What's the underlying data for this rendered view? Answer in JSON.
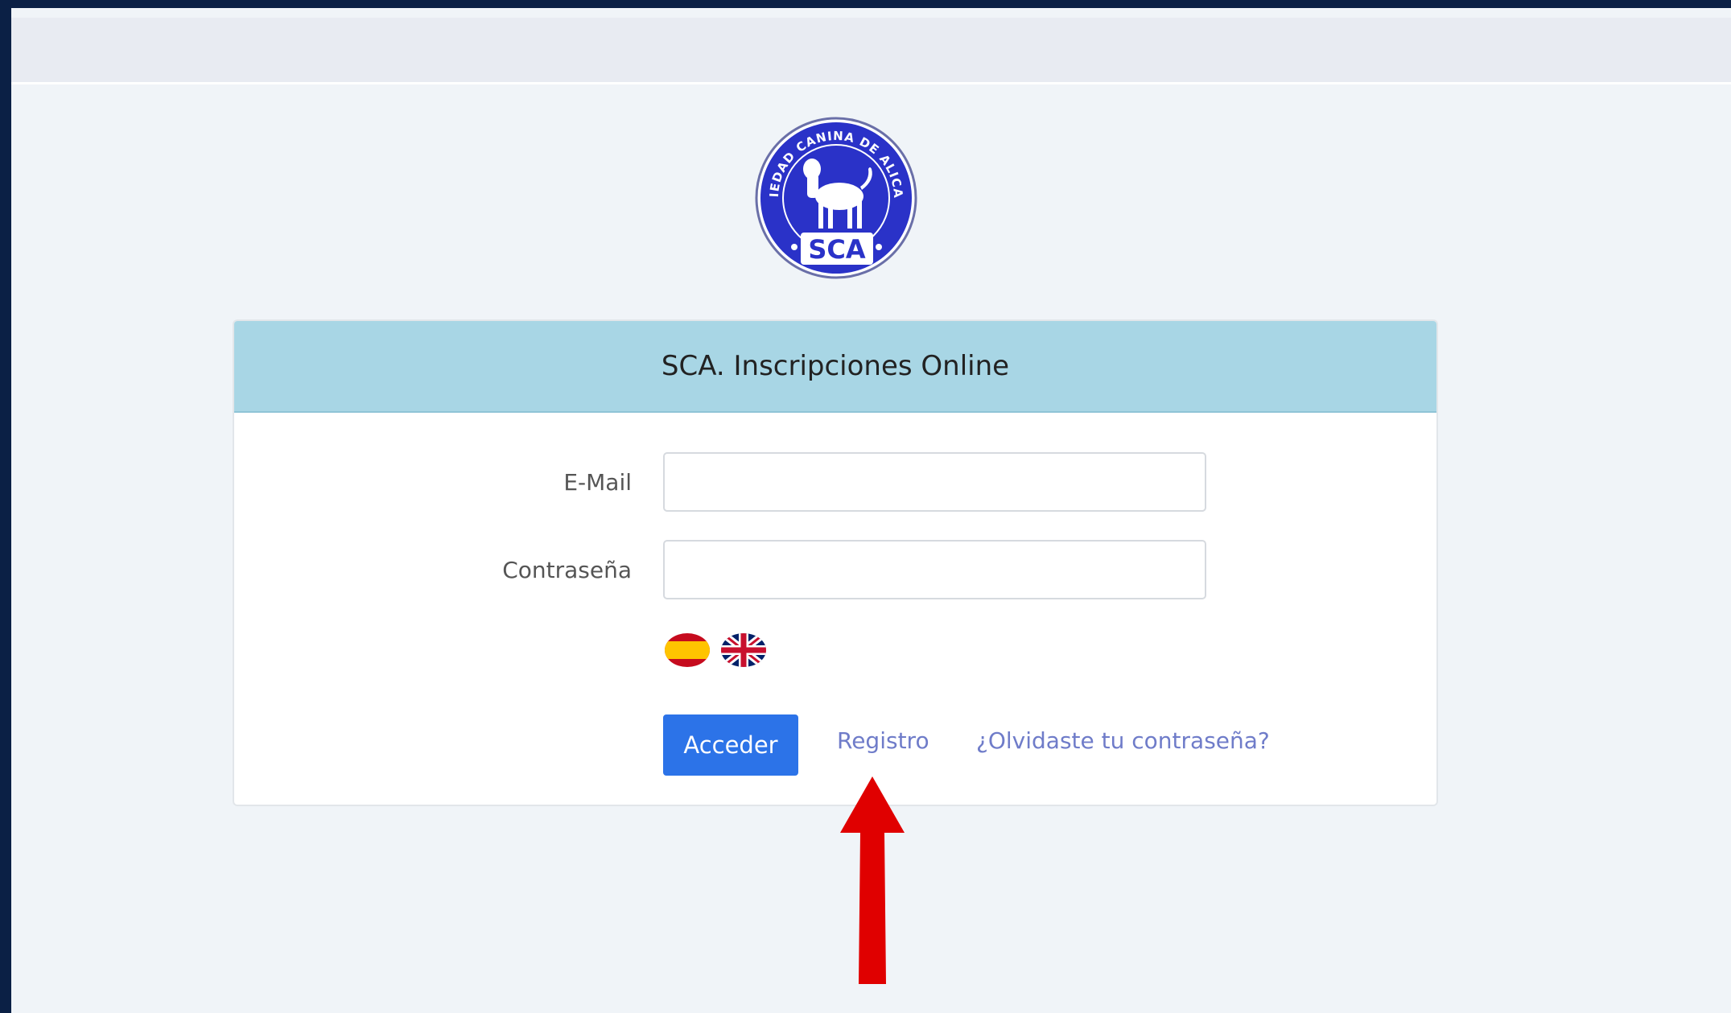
{
  "logo": {
    "top_text": "SOCIEDAD CANINA DE ALICANTE",
    "bottom_text": "SCA",
    "brand_color": "#2a32c8"
  },
  "card": {
    "title": "SCA. Inscripciones Online"
  },
  "form": {
    "email_label": "E-Mail",
    "email_value": "",
    "password_label": "Contraseña",
    "password_value": "",
    "login_button": "Acceder",
    "register_link": "Registro",
    "forgot_link": "¿Olvidaste tu contraseña?"
  },
  "languages": [
    "spain-flag-icon",
    "uk-flag-icon"
  ],
  "annotation": {
    "arrow_color": "#e00000",
    "icon": "up-arrow-icon"
  }
}
